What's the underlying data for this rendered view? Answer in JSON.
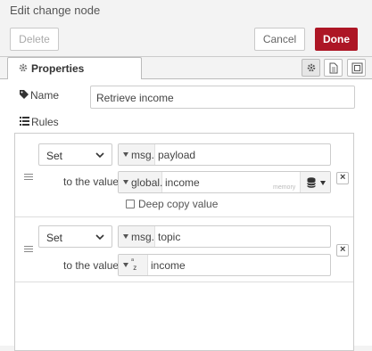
{
  "tray": {
    "title": "Edit change node"
  },
  "toolbar": {
    "delete_label": "Delete",
    "cancel_label": "Cancel",
    "done_label": "Done"
  },
  "tabs": [
    {
      "label": "Properties",
      "icon": "gear-icon"
    }
  ],
  "tab_icons": [
    "gear-icon",
    "document-icon",
    "frame-icon"
  ],
  "form": {
    "name_label": "Name",
    "name_value": "Retrieve income",
    "rules_label": "Rules"
  },
  "rules": [
    {
      "action": "Set",
      "target_type": "msg.",
      "target_value": "payload",
      "to_label": "to the value",
      "value_type": "global.",
      "value_value": "income",
      "value_hint": "memory",
      "deep_copy_label": "Deep copy value",
      "deep_copy_checked": false
    },
    {
      "action": "Set",
      "target_type": "msg.",
      "target_value": "topic",
      "to_label": "to the value",
      "value_type_icon": "a/z",
      "value_value": "income"
    }
  ],
  "colors": {
    "primary": "#ad1625",
    "background": "#f3f3f3"
  }
}
